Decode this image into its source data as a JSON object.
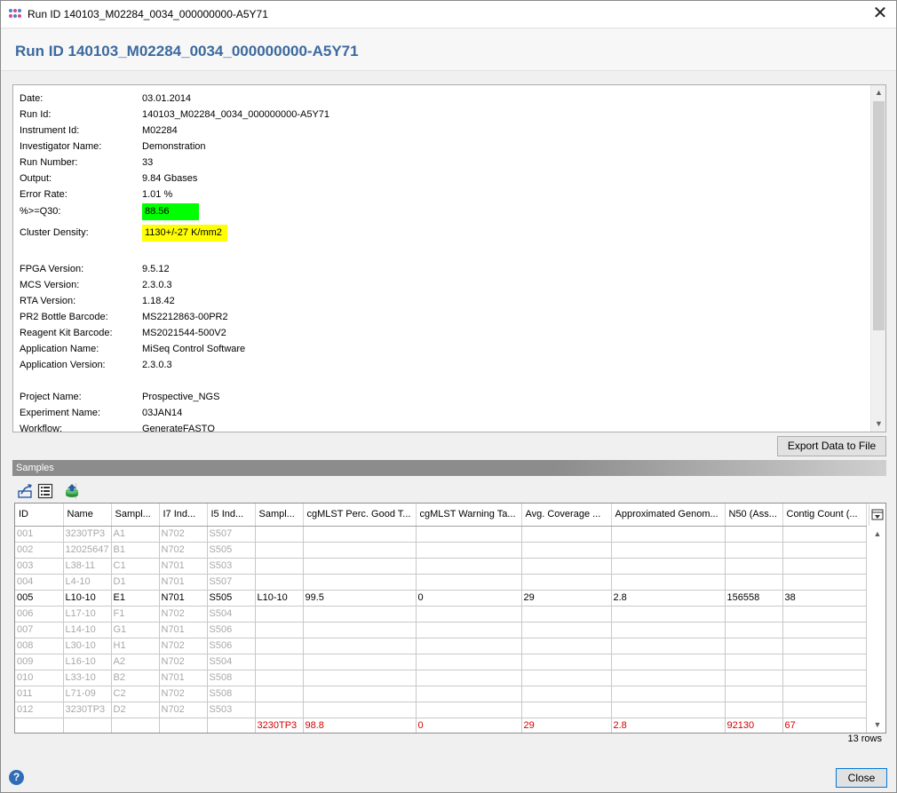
{
  "window": {
    "title": "Run ID 140103_M02284_0034_000000000-A5Y71",
    "heading": "Run ID 140103_M02284_0034_000000000-A5Y71",
    "close_symbol": "✕"
  },
  "run_info": {
    "rows": [
      {
        "label": "Date:",
        "value": "03.01.2014"
      },
      {
        "label": "Run Id:",
        "value": "140103_M02284_0034_000000000-A5Y71"
      },
      {
        "label": "Instrument Id:",
        "value": "M02284"
      },
      {
        "label": "Investigator Name:",
        "value": "Demonstration"
      },
      {
        "label": "Run Number:",
        "value": "33"
      },
      {
        "label": "Output:",
        "value": "9.84  Gbases"
      },
      {
        "label": "Error Rate:",
        "value": "1.01 %"
      },
      {
        "label": "%>=Q30:",
        "value": "88.56",
        "highlight": "#00ff00"
      },
      {
        "label": "Cluster Density:",
        "value": "1130+/-27  K/mm2",
        "highlight": "#ffff00"
      },
      {
        "label": "FPGA Version:",
        "value": "9.5.12"
      },
      {
        "label": "MCS Version:",
        "value": "2.3.0.3"
      },
      {
        "label": "RTA Version:",
        "value": "1.18.42"
      },
      {
        "label": "PR2 Bottle Barcode:",
        "value": "MS2212863-00PR2"
      },
      {
        "label": "Reagent Kit Barcode:",
        "value": "MS2021544-500V2"
      },
      {
        "label": "Application Name:",
        "value": "MiSeq Control Software"
      },
      {
        "label": "Application Version:",
        "value": "2.3.0.3"
      },
      {
        "label": "Project Name:",
        "value": "Prospective_NGS"
      },
      {
        "label": "Experiment Name:",
        "value": "03JAN14"
      },
      {
        "label": "Workflow:",
        "value": "GenerateFASTQ"
      }
    ]
  },
  "buttons": {
    "export": "Export Data to File",
    "close": "Close"
  },
  "samples": {
    "section_title": "Samples",
    "toolbar_icons": [
      "export-chart-icon",
      "table-view-icon",
      "database-upload-icon"
    ],
    "columns": [
      "ID",
      "Name",
      "Sampl...",
      "I7 Ind...",
      "I5 Ind...",
      "Sampl...",
      "cgMLST Perc. Good T...",
      "cgMLST Warning Ta...",
      "Avg. Coverage ...",
      "Approximated Genom...",
      "N50 (Ass...",
      "Contig Count (..."
    ],
    "rows": [
      {
        "state": "dim",
        "cells": [
          "001",
          "3230TP3",
          "A1",
          "N702",
          "S507",
          "",
          "",
          "",
          "",
          "",
          "",
          ""
        ]
      },
      {
        "state": "dim",
        "cells": [
          "002",
          "12025647",
          "B1",
          "N702",
          "S505",
          "",
          "",
          "",
          "",
          "",
          "",
          ""
        ]
      },
      {
        "state": "dim",
        "cells": [
          "003",
          "L38-11",
          "C1",
          "N701",
          "S503",
          "",
          "",
          "",
          "",
          "",
          "",
          ""
        ]
      },
      {
        "state": "dim",
        "cells": [
          "004",
          "L4-10",
          "D1",
          "N701",
          "S507",
          "",
          "",
          "",
          "",
          "",
          "",
          ""
        ]
      },
      {
        "state": "active",
        "cells": [
          "005",
          "L10-10",
          "E1",
          "N701",
          "S505",
          "L10-10",
          "99.5",
          "0",
          "29",
          "2.8",
          "156558",
          "38"
        ]
      },
      {
        "state": "dim",
        "cells": [
          "006",
          "L17-10",
          "F1",
          "N702",
          "S504",
          "",
          "",
          "",
          "",
          "",
          "",
          ""
        ]
      },
      {
        "state": "dim",
        "cells": [
          "007",
          "L14-10",
          "G1",
          "N701",
          "S506",
          "",
          "",
          "",
          "",
          "",
          "",
          ""
        ]
      },
      {
        "state": "dim",
        "cells": [
          "008",
          "L30-10",
          "H1",
          "N702",
          "S506",
          "",
          "",
          "",
          "",
          "",
          "",
          ""
        ]
      },
      {
        "state": "dim",
        "cells": [
          "009",
          "L16-10",
          "A2",
          "N702",
          "S504",
          "",
          "",
          "",
          "",
          "",
          "",
          ""
        ]
      },
      {
        "state": "dim",
        "cells": [
          "010",
          "L33-10",
          "B2",
          "N701",
          "S508",
          "",
          "",
          "",
          "",
          "",
          "",
          ""
        ]
      },
      {
        "state": "dim",
        "cells": [
          "011",
          "L71-09",
          "C2",
          "N702",
          "S508",
          "",
          "",
          "",
          "",
          "",
          "",
          ""
        ]
      },
      {
        "state": "dim",
        "cells": [
          "012",
          "3230TP3",
          "D2",
          "N702",
          "S503",
          "",
          "",
          "",
          "",
          "",
          "",
          ""
        ]
      },
      {
        "state": "summary",
        "cells": [
          "",
          "",
          "",
          "",
          "",
          "3230TP3",
          "98.8",
          "0",
          "29",
          "2.8",
          "92130",
          "67"
        ]
      }
    ],
    "row_count": "13 rows"
  },
  "help": {
    "symbol": "?"
  },
  "colors": {
    "heading": "#3c6a9e",
    "q30_highlight": "#00ff00",
    "density_highlight": "#ffff00",
    "summary_row": "#d40000"
  }
}
